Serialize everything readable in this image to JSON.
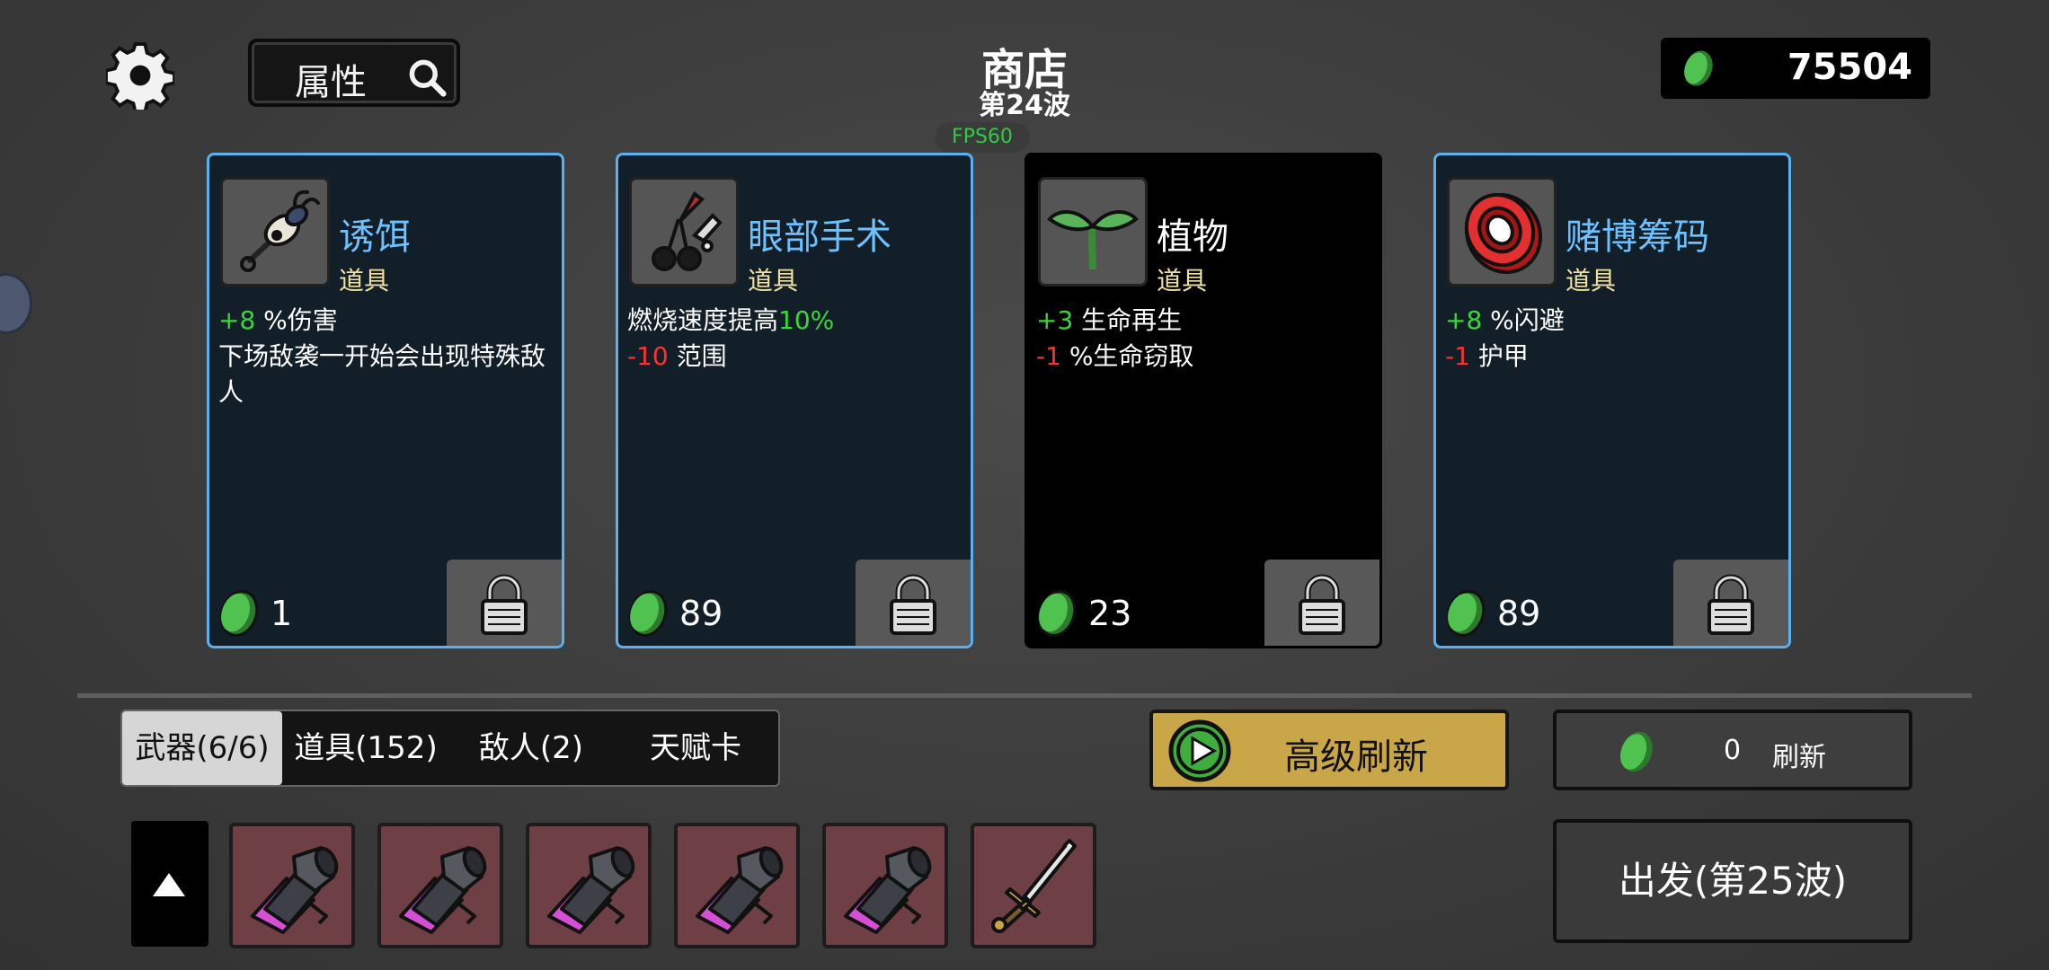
{
  "header": {
    "title": "商店",
    "wave": "第24波",
    "fps": "FPS60",
    "attributes_label": "属性",
    "currency": "75504"
  },
  "cards": [
    {
      "name": "诱饵",
      "type": "道具",
      "icon": "bait-icon",
      "lines": [
        [
          {
            "t": "+8",
            "c": "pos"
          },
          {
            "t": " %伤害",
            "c": ""
          }
        ],
        [
          {
            "t": "下场敌袭一开始会出现特殊敌人",
            "c": ""
          }
        ]
      ],
      "price": "1",
      "style": "blue"
    },
    {
      "name": "眼部手术",
      "type": "道具",
      "icon": "eye-surgery-icon",
      "lines": [
        [
          {
            "t": "燃烧速度提高",
            "c": ""
          },
          {
            "t": "10%",
            "c": "pos"
          }
        ],
        [
          {
            "t": "-10",
            "c": "neg"
          },
          {
            "t": " 范围",
            "c": ""
          }
        ]
      ],
      "price": "89",
      "style": "blue"
    },
    {
      "name": "植物",
      "type": "道具",
      "icon": "plant-icon",
      "lines": [
        [
          {
            "t": "+3",
            "c": "pos"
          },
          {
            "t": " 生命再生",
            "c": ""
          }
        ],
        [
          {
            "t": "-1",
            "c": "neg"
          },
          {
            "t": " %生命窃取",
            "c": ""
          }
        ]
      ],
      "price": "23",
      "style": "black"
    },
    {
      "name": "赌博筹码",
      "type": "道具",
      "icon": "gambling-chip-icon",
      "lines": [
        [
          {
            "t": "+8",
            "c": "pos"
          },
          {
            "t": " %闪避",
            "c": ""
          }
        ],
        [
          {
            "t": "-1",
            "c": "neg"
          },
          {
            "t": " 护甲",
            "c": ""
          }
        ]
      ],
      "price": "89",
      "style": "blue"
    }
  ],
  "tabs": [
    {
      "label": "武器(6/6)",
      "active": true
    },
    {
      "label": "道具(152)",
      "active": false
    },
    {
      "label": "敌人(2)",
      "active": false
    },
    {
      "label": "天赋卡",
      "active": false
    }
  ],
  "buttons": {
    "advanced_refresh": "高级刷新",
    "refresh_cost": "0",
    "refresh_label": "刷新",
    "depart": "出发(第25波)"
  },
  "weapons": [
    "launcher-icon",
    "launcher-icon",
    "launcher-icon",
    "launcher-icon",
    "launcher-icon",
    "sword-icon"
  ],
  "colors": {
    "card_border": "#5ab0f0",
    "item_name": "#6ec1ff",
    "positive": "#3ad63a",
    "negative": "#ff3030",
    "gold_button": "#c9a647",
    "coin": "#4fc24f",
    "weapon_slot": "#6e3f44"
  }
}
